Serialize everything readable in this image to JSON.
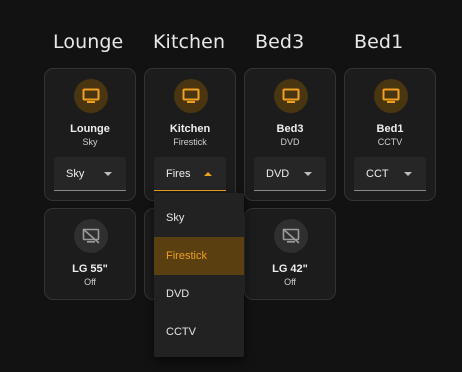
{
  "rooms": [
    {
      "heading": "Lounge",
      "name": "Lounge",
      "source": "Sky",
      "select_value": "Sky"
    },
    {
      "heading": "Kitchen",
      "name": "Kitchen",
      "source": "Firestick",
      "select_value": "Fires"
    },
    {
      "heading": "Bed3",
      "name": "Bed3",
      "source": "DVD",
      "select_value": "DVD"
    },
    {
      "heading": "Bed1",
      "name": "Bed1",
      "source": "CCTV",
      "select_value": "CCT"
    }
  ],
  "tvs": [
    {
      "name": "LG 55\"",
      "state": "Off"
    },
    {
      "name": "LG 42\"",
      "state": "Off"
    }
  ],
  "dropdown": {
    "options": [
      "Sky",
      "Firestick",
      "DVD",
      "CCTV"
    ],
    "selected": "Firestick"
  },
  "colors": {
    "accent": "#f0a020",
    "background": "#121212",
    "card": "#1c1c1c"
  },
  "icons": {
    "active": "tv-icon",
    "inactive": "tv-off-icon"
  }
}
